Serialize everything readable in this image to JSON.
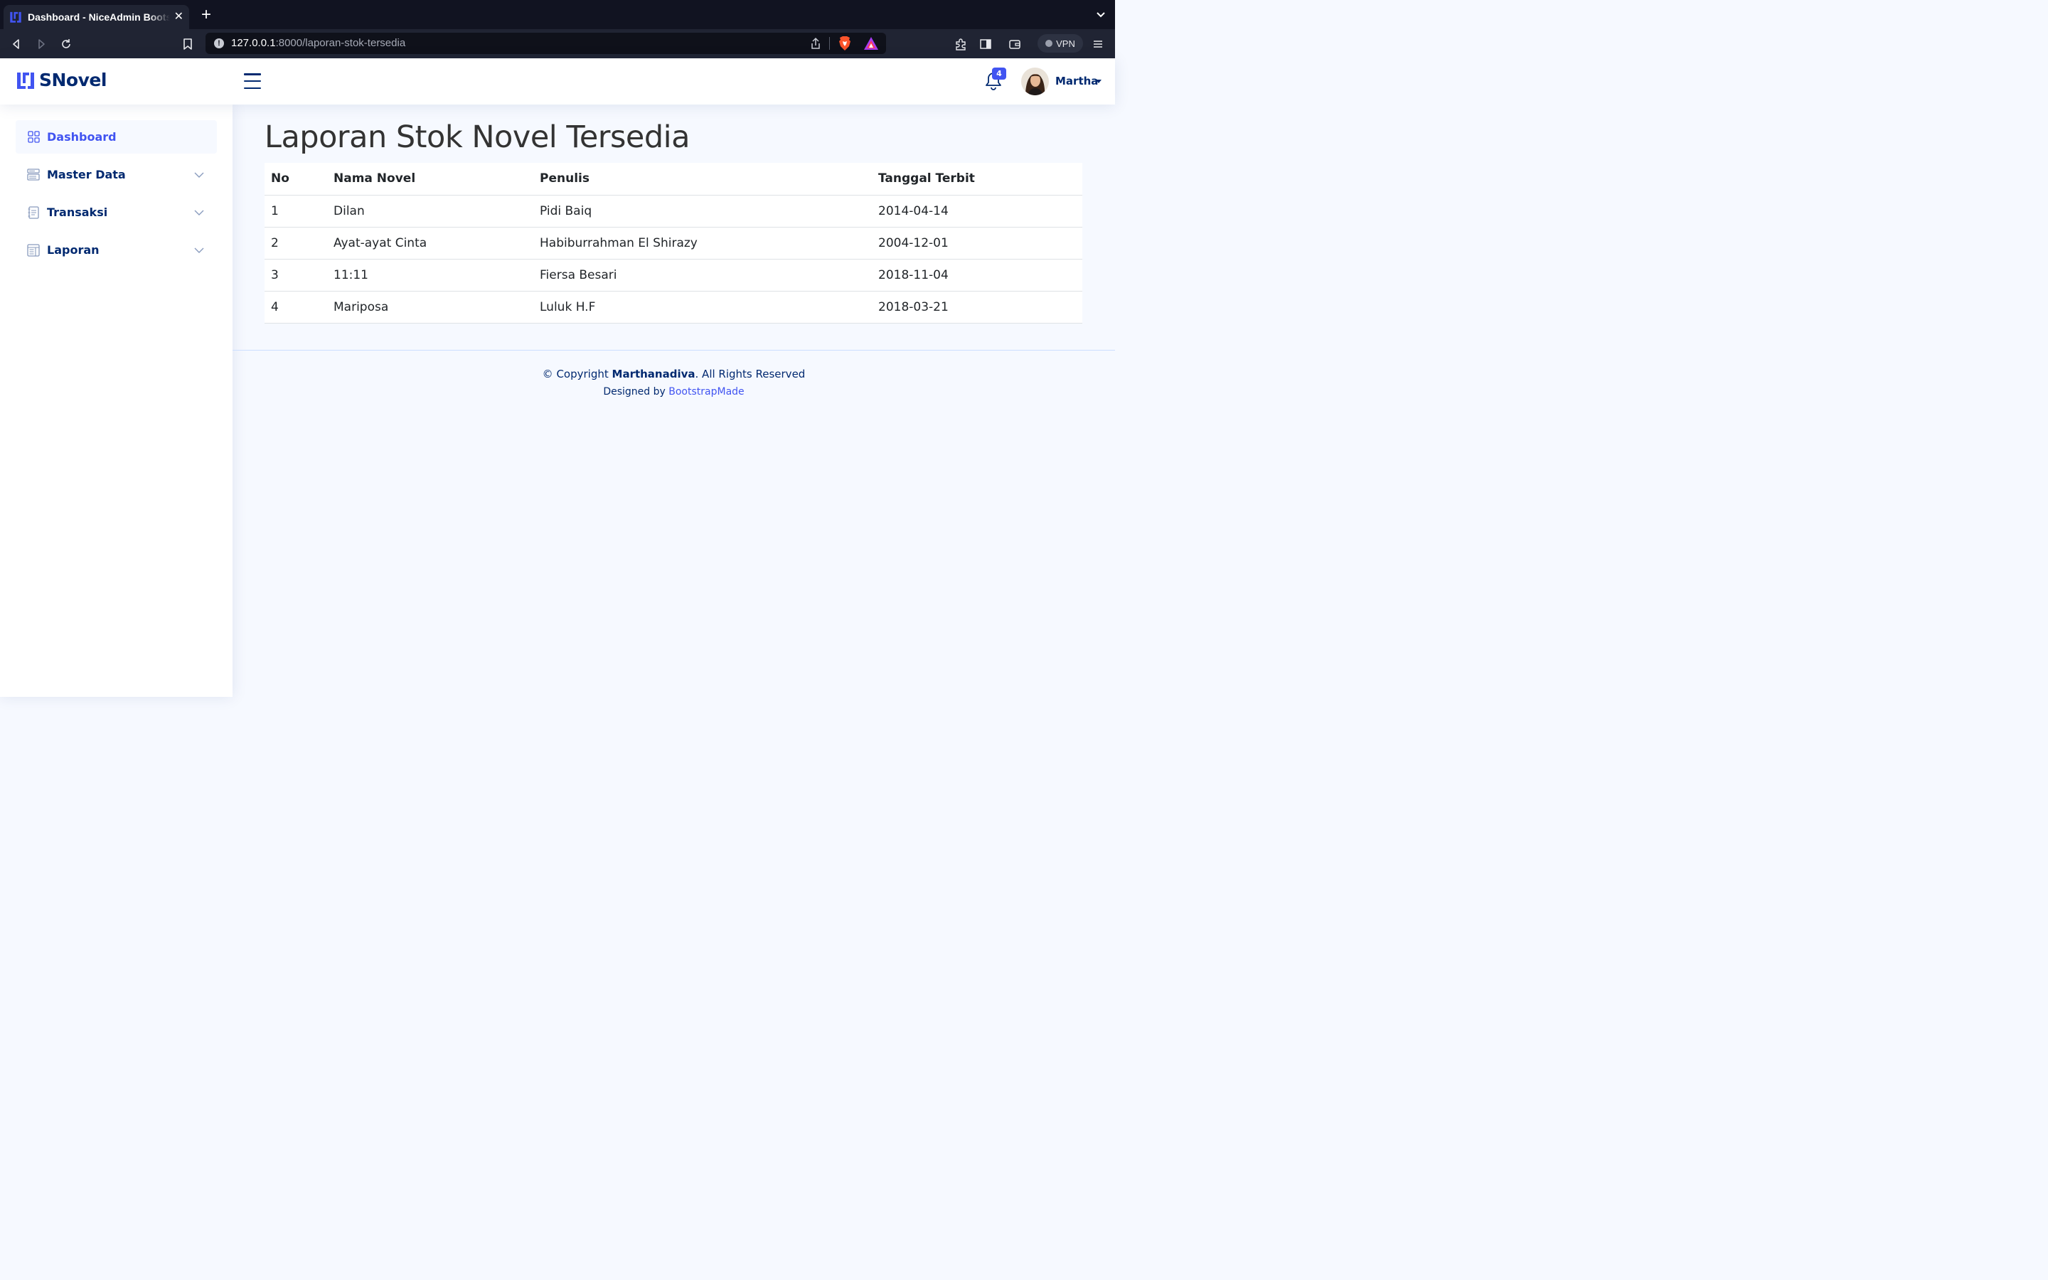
{
  "browser": {
    "tab_title": "Dashboard - NiceAdmin Bootstrap Template",
    "url_host": "127.0.0.1",
    "url_rest": ":8000/laporan-stok-tersedia",
    "vpn_label": "VPN"
  },
  "header": {
    "logo_text": "SNovel",
    "notification_count": "4",
    "profile_name": "Martha"
  },
  "sidebar": {
    "items": [
      {
        "label": "Dashboard",
        "icon": "grid-icon",
        "active": true
      },
      {
        "label": "Master Data",
        "icon": "menu-button-icon",
        "expandable": true
      },
      {
        "label": "Transaksi",
        "icon": "journal-text-icon",
        "expandable": true
      },
      {
        "label": "Laporan",
        "icon": "layout-text-window-icon",
        "expandable": true
      }
    ]
  },
  "main": {
    "title": "Laporan Stok Novel Tersedia",
    "table": {
      "headers": [
        "No",
        "Nama Novel",
        "Penulis",
        "Tanggal Terbit"
      ],
      "rows": [
        [
          "1",
          "Dilan",
          "Pidi Baiq",
          "2014-04-14"
        ],
        [
          "2",
          "Ayat-ayat Cinta",
          "Habiburrahman El Shirazy",
          "2004-12-01"
        ],
        [
          "3",
          "11:11",
          "Fiersa Besari",
          "2018-11-04"
        ],
        [
          "4",
          "Mariposa",
          "Luluk H.F",
          "2018-03-21"
        ]
      ]
    }
  },
  "footer": {
    "copyright_prefix": "© Copyright ",
    "copyright_owner": "Marthanadiva",
    "copyright_suffix": ". All Rights Reserved",
    "designed_by": "Designed by ",
    "designer_link": "BootstrapMade"
  },
  "colors": {
    "primary": "#4154f1",
    "navy": "#012970",
    "background": "#f6f9ff",
    "chrome_dark": "#111321",
    "chrome_toolbar": "#202433"
  }
}
